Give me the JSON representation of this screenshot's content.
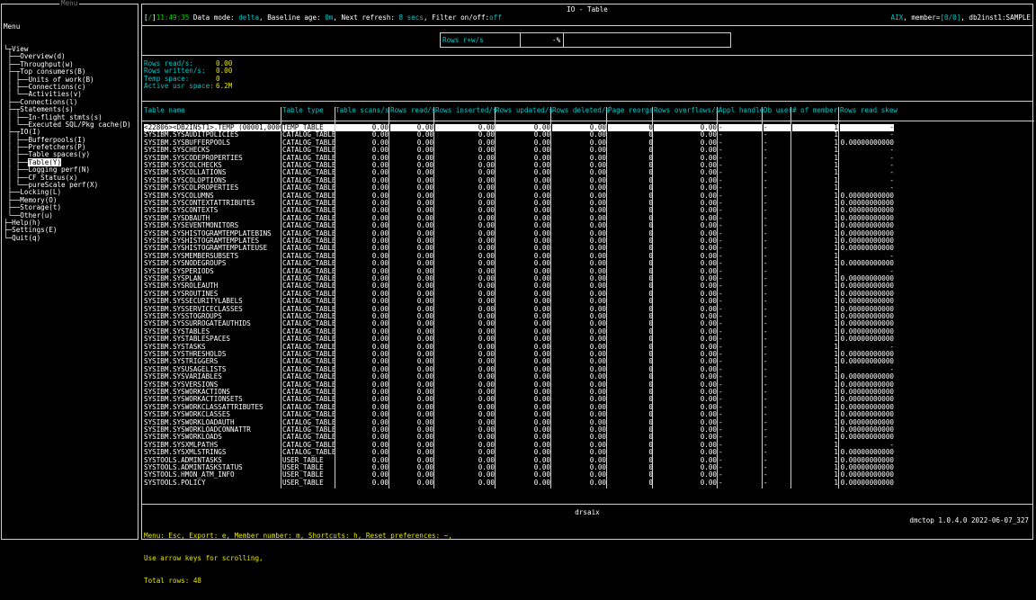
{
  "menu": {
    "caption": "Menu",
    "title": "Menu",
    "items": [
      {
        "prefix": "└┬",
        "label": "View"
      },
      {
        "prefix": " ├──",
        "label": "Overview(d)"
      },
      {
        "prefix": " ├──",
        "label": "Throughput(w)"
      },
      {
        "prefix": " ├─┬",
        "label": "Top consumers(B)"
      },
      {
        "prefix": " │ ├──",
        "label": "Units of work(B)"
      },
      {
        "prefix": " │ ├──",
        "label": "Connections(c)"
      },
      {
        "prefix": " │ └──",
        "label": "Activities(v)"
      },
      {
        "prefix": " ├──",
        "label": "Connections(l)"
      },
      {
        "prefix": " ├─┬",
        "label": "Statements(s)"
      },
      {
        "prefix": " │ ├──",
        "label": "In-flight stmts(s)"
      },
      {
        "prefix": " │ └──",
        "label": "Executed SQL/Pkg cache(D)"
      },
      {
        "prefix": " ├─┬",
        "label": "IO(I)"
      },
      {
        "prefix": " │ ├──",
        "label": "Bufferpools(I)"
      },
      {
        "prefix": " │ ├──",
        "label": "Prefetchers(P)"
      },
      {
        "prefix": " │ ├──",
        "label": "Table spaces(y)"
      },
      {
        "prefix": " │ ├──",
        "label": "Table(Y)",
        "selected": true
      },
      {
        "prefix": " │ ├──",
        "label": "Logging perf(N)"
      },
      {
        "prefix": " │ ├──",
        "label": "CF Status(x)"
      },
      {
        "prefix": " │ └──",
        "label": "pureScale perf(X)"
      },
      {
        "prefix": " ├──",
        "label": "Locking(L)"
      },
      {
        "prefix": " ├──",
        "label": "Memory(O)"
      },
      {
        "prefix": " ├──",
        "label": "Storage(t)"
      },
      {
        "prefix": " └──",
        "label": "Other(u)"
      },
      {
        "prefix": "├─",
        "label": "Help(h)"
      },
      {
        "prefix": "├─",
        "label": "Settings(E)"
      },
      {
        "prefix": "└─",
        "label": "Quit(q)"
      }
    ]
  },
  "window": {
    "title": "IO - Table",
    "status": {
      "bracket_open": "[",
      "indicator": "/",
      "bracket_close": "]",
      "time": "11:49:35",
      "data_mode_label": " Data mode: ",
      "data_mode": "delta",
      "baseline_label": ", Baseline age: ",
      "baseline": "0m",
      "refresh_label": ", Next refresh: ",
      "refresh": "8 secs",
      "filter_label": ", Filter on/off:",
      "filter": "off",
      "platform": "AIX",
      "member_label": ", member=",
      "member": "[0/0]",
      "instance": ", db2inst1:SAMPLE"
    }
  },
  "gauge": {
    "label": "Rows r+w/s",
    "value": "-%"
  },
  "metrics": [
    {
      "label": "Rows read/s:",
      "value": "0.00"
    },
    {
      "label": "Rows written/s:",
      "value": "0.00"
    },
    {
      "label": "Temp space:",
      "value": "0"
    },
    {
      "label": "Active usr space:",
      "value": "6.2M"
    }
  ],
  "table": {
    "columns": [
      "Table name",
      "Table type",
      "Table scans/s",
      "Rows read/s",
      "Rows inserted/s",
      "Rows updated/s",
      "Rows deleted/s",
      "Page reorgs",
      "Rows overflows/s",
      "Appl handle",
      "Db user",
      "# of member",
      "Rows read skew"
    ],
    "rows": [
      [
        "<22806><DB2INST1>.TEMP (00001,00002)",
        "TEMP_TABLE",
        "0.00",
        "0.00",
        "0.00",
        "0.00",
        "0.00",
        "0",
        "0.00",
        "-",
        "-",
        "1",
        "-"
      ],
      [
        "SYSIBM.SYSAUDITPOLICIES",
        "CATALOG_TABLE",
        "0.00",
        "0.00",
        "0.00",
        "0.00",
        "0.00",
        "0",
        "0.00",
        "-",
        "-",
        "1",
        "-"
      ],
      [
        "SYSIBM.SYSBUFFERPOOLS",
        "CATALOG_TABLE",
        "0.00",
        "0.00",
        "0.00",
        "0.00",
        "0.00",
        "0",
        "0.00",
        "-",
        "-",
        "1",
        "0.00000000000"
      ],
      [
        "SYSIBM.SYSCHECKS",
        "CATALOG_TABLE",
        "0.00",
        "0.00",
        "0.00",
        "0.00",
        "0.00",
        "0",
        "0.00",
        "-",
        "-",
        "1",
        "-"
      ],
      [
        "SYSIBM.SYSCODEPROPERTIES",
        "CATALOG_TABLE",
        "0.00",
        "0.00",
        "0.00",
        "0.00",
        "0.00",
        "0",
        "0.00",
        "-",
        "-",
        "1",
        "-"
      ],
      [
        "SYSIBM.SYSCOLCHECKS",
        "CATALOG_TABLE",
        "0.00",
        "0.00",
        "0.00",
        "0.00",
        "0.00",
        "0",
        "0.00",
        "-",
        "-",
        "1",
        "-"
      ],
      [
        "SYSIBM.SYSCOLLATIONS",
        "CATALOG_TABLE",
        "0.00",
        "0.00",
        "0.00",
        "0.00",
        "0.00",
        "0",
        "0.00",
        "-",
        "-",
        "1",
        "-"
      ],
      [
        "SYSIBM.SYSCOLOPTIONS",
        "CATALOG_TABLE",
        "0.00",
        "0.00",
        "0.00",
        "0.00",
        "0.00",
        "0",
        "0.00",
        "-",
        "-",
        "1",
        "-"
      ],
      [
        "SYSIBM.SYSCOLPROPERTIES",
        "CATALOG_TABLE",
        "0.00",
        "0.00",
        "0.00",
        "0.00",
        "0.00",
        "0",
        "0.00",
        "-",
        "-",
        "1",
        "-"
      ],
      [
        "SYSIBM.SYSCOLUMNS",
        "CATALOG_TABLE",
        "0.00",
        "0.00",
        "0.00",
        "0.00",
        "0.00",
        "0",
        "0.00",
        "-",
        "-",
        "1",
        "0.00000000000"
      ],
      [
        "SYSIBM.SYSCONTEXTATTRIBUTES",
        "CATALOG_TABLE",
        "0.00",
        "0.00",
        "0.00",
        "0.00",
        "0.00",
        "0",
        "0.00",
        "-",
        "-",
        "1",
        "0.00000000000"
      ],
      [
        "SYSIBM.SYSCONTEXTS",
        "CATALOG_TABLE",
        "0.00",
        "0.00",
        "0.00",
        "0.00",
        "0.00",
        "0",
        "0.00",
        "-",
        "-",
        "1",
        "0.00000000000"
      ],
      [
        "SYSIBM.SYSDBAUTH",
        "CATALOG_TABLE",
        "0.00",
        "0.00",
        "0.00",
        "0.00",
        "0.00",
        "0",
        "0.00",
        "-",
        "-",
        "1",
        "0.00000000000"
      ],
      [
        "SYSIBM.SYSEVENTMONITORS",
        "CATALOG_TABLE",
        "0.00",
        "0.00",
        "0.00",
        "0.00",
        "0.00",
        "0",
        "0.00",
        "-",
        "-",
        "1",
        "0.00000000000"
      ],
      [
        "SYSIBM.SYSHISTOGRAMTEMPLATEBINS",
        "CATALOG_TABLE",
        "0.00",
        "0.00",
        "0.00",
        "0.00",
        "0.00",
        "0",
        "0.00",
        "-",
        "-",
        "1",
        "0.00000000000"
      ],
      [
        "SYSIBM.SYSHISTOGRAMTEMPLATES",
        "CATALOG_TABLE",
        "0.00",
        "0.00",
        "0.00",
        "0.00",
        "0.00",
        "0",
        "0.00",
        "-",
        "-",
        "1",
        "0.00000000000"
      ],
      [
        "SYSIBM.SYSHISTOGRAMTEMPLATEUSE",
        "CATALOG_TABLE",
        "0.00",
        "0.00",
        "0.00",
        "0.00",
        "0.00",
        "0",
        "0.00",
        "-",
        "-",
        "1",
        "0.00000000000"
      ],
      [
        "SYSIBM.SYSMEMBERSUBSETS",
        "CATALOG_TABLE",
        "0.00",
        "0.00",
        "0.00",
        "0.00",
        "0.00",
        "0",
        "0.00",
        "-",
        "-",
        "1",
        "-"
      ],
      [
        "SYSIBM.SYSNODEGROUPS",
        "CATALOG_TABLE",
        "0.00",
        "0.00",
        "0.00",
        "0.00",
        "0.00",
        "0",
        "0.00",
        "-",
        "-",
        "1",
        "0.00000000000"
      ],
      [
        "SYSIBM.SYSPERIODS",
        "CATALOG_TABLE",
        "0.00",
        "0.00",
        "0.00",
        "0.00",
        "0.00",
        "0",
        "0.00",
        "-",
        "-",
        "1",
        "-"
      ],
      [
        "SYSIBM.SYSPLAN",
        "CATALOG_TABLE",
        "0.00",
        "0.00",
        "0.00",
        "0.00",
        "0.00",
        "0",
        "0.00",
        "-",
        "-",
        "1",
        "0.00000000000"
      ],
      [
        "SYSIBM.SYSROLEAUTH",
        "CATALOG_TABLE",
        "0.00",
        "0.00",
        "0.00",
        "0.00",
        "0.00",
        "0",
        "0.00",
        "-",
        "-",
        "1",
        "0.00000000000"
      ],
      [
        "SYSIBM.SYSROUTINES",
        "CATALOG_TABLE",
        "0.00",
        "0.00",
        "0.00",
        "0.00",
        "0.00",
        "0",
        "0.00",
        "-",
        "-",
        "1",
        "0.00000000000"
      ],
      [
        "SYSIBM.SYSSECURITYLABELS",
        "CATALOG_TABLE",
        "0.00",
        "0.00",
        "0.00",
        "0.00",
        "0.00",
        "0",
        "0.00",
        "-",
        "-",
        "1",
        "0.00000000000"
      ],
      [
        "SYSIBM.SYSSERVICECLASSES",
        "CATALOG_TABLE",
        "0.00",
        "0.00",
        "0.00",
        "0.00",
        "0.00",
        "0",
        "0.00",
        "-",
        "-",
        "1",
        "0.00000000000"
      ],
      [
        "SYSIBM.SYSSTOGROUPS",
        "CATALOG_TABLE",
        "0.00",
        "0.00",
        "0.00",
        "0.00",
        "0.00",
        "0",
        "0.00",
        "-",
        "-",
        "1",
        "0.00000000000"
      ],
      [
        "SYSIBM.SYSSURROGATEAUTHIDS",
        "CATALOG_TABLE",
        "0.00",
        "0.00",
        "0.00",
        "0.00",
        "0.00",
        "0",
        "0.00",
        "-",
        "-",
        "1",
        "0.00000000000"
      ],
      [
        "SYSIBM.SYSTABLES",
        "CATALOG_TABLE",
        "0.00",
        "0.00",
        "0.00",
        "0.00",
        "0.00",
        "0",
        "0.00",
        "-",
        "-",
        "1",
        "0.00000000000"
      ],
      [
        "SYSIBM.SYSTABLESPACES",
        "CATALOG_TABLE",
        "0.00",
        "0.00",
        "0.00",
        "0.00",
        "0.00",
        "0",
        "0.00",
        "-",
        "-",
        "1",
        "0.00000000000"
      ],
      [
        "SYSIBM.SYSTASKS",
        "CATALOG_TABLE",
        "0.00",
        "0.00",
        "0.00",
        "0.00",
        "0.00",
        "0",
        "0.00",
        "-",
        "-",
        "1",
        "-"
      ],
      [
        "SYSIBM.SYSTHRESHOLDS",
        "CATALOG_TABLE",
        "0.00",
        "0.00",
        "0.00",
        "0.00",
        "0.00",
        "0",
        "0.00",
        "-",
        "-",
        "1",
        "0.00000000000"
      ],
      [
        "SYSIBM.SYSTRIGGERS",
        "CATALOG_TABLE",
        "0.00",
        "0.00",
        "0.00",
        "0.00",
        "0.00",
        "0",
        "0.00",
        "-",
        "-",
        "1",
        "0.00000000000"
      ],
      [
        "SYSIBM.SYSUSAGELISTS",
        "CATALOG_TABLE",
        "0.00",
        "0.00",
        "0.00",
        "0.00",
        "0.00",
        "0",
        "0.00",
        "-",
        "-",
        "1",
        "-"
      ],
      [
        "SYSIBM.SYSVARIABLES",
        "CATALOG_TABLE",
        "0.00",
        "0.00",
        "0.00",
        "0.00",
        "0.00",
        "0",
        "0.00",
        "-",
        "-",
        "1",
        "0.00000000000"
      ],
      [
        "SYSIBM.SYSVERSIONS",
        "CATALOG_TABLE",
        "0.00",
        "0.00",
        "0.00",
        "0.00",
        "0.00",
        "0",
        "0.00",
        "-",
        "-",
        "1",
        "0.00000000000"
      ],
      [
        "SYSIBM.SYSWORKACTIONS",
        "CATALOG_TABLE",
        "0.00",
        "0.00",
        "0.00",
        "0.00",
        "0.00",
        "0",
        "0.00",
        "-",
        "-",
        "1",
        "0.00000000000"
      ],
      [
        "SYSIBM.SYSWORKACTIONSETS",
        "CATALOG_TABLE",
        "0.00",
        "0.00",
        "0.00",
        "0.00",
        "0.00",
        "0",
        "0.00",
        "-",
        "-",
        "1",
        "0.00000000000"
      ],
      [
        "SYSIBM.SYSWORKCLASSATTRIBUTES",
        "CATALOG_TABLE",
        "0.00",
        "0.00",
        "0.00",
        "0.00",
        "0.00",
        "0",
        "0.00",
        "-",
        "-",
        "1",
        "0.00000000000"
      ],
      [
        "SYSIBM.SYSWORKCLASSES",
        "CATALOG_TABLE",
        "0.00",
        "0.00",
        "0.00",
        "0.00",
        "0.00",
        "0",
        "0.00",
        "-",
        "-",
        "1",
        "0.00000000000"
      ],
      [
        "SYSIBM.SYSWORKLOADAUTH",
        "CATALOG_TABLE",
        "0.00",
        "0.00",
        "0.00",
        "0.00",
        "0.00",
        "0",
        "0.00",
        "-",
        "-",
        "1",
        "0.00000000000"
      ],
      [
        "SYSIBM.SYSWORKLOADCONNATTR",
        "CATALOG_TABLE",
        "0.00",
        "0.00",
        "0.00",
        "0.00",
        "0.00",
        "0",
        "0.00",
        "-",
        "-",
        "1",
        "0.00000000000"
      ],
      [
        "SYSIBM.SYSWORKLOADS",
        "CATALOG_TABLE",
        "0.00",
        "0.00",
        "0.00",
        "0.00",
        "0.00",
        "0",
        "0.00",
        "-",
        "-",
        "1",
        "0.00000000000"
      ],
      [
        "SYSIBM.SYSXMLPATHS",
        "CATALOG_TABLE",
        "0.00",
        "0.00",
        "0.00",
        "0.00",
        "0.00",
        "0",
        "0.00",
        "-",
        "-",
        "1",
        "-"
      ],
      [
        "SYSIBM.SYSXMLSTRINGS",
        "CATALOG_TABLE",
        "0.00",
        "0.00",
        "0.00",
        "0.00",
        "0.00",
        "0",
        "0.00",
        "-",
        "-",
        "1",
        "0.00000000000"
      ],
      [
        "SYSTOOLS.ADMINTASKS",
        "USER_TABLE",
        "0.00",
        "0.00",
        "0.00",
        "0.00",
        "0.00",
        "0",
        "0.00",
        "-",
        "-",
        "1",
        "0.00000000000"
      ],
      [
        "SYSTOOLS.ADMINTASKSTATUS",
        "USER_TABLE",
        "0.00",
        "0.00",
        "0.00",
        "0.00",
        "0.00",
        "0",
        "0.00",
        "-",
        "-",
        "1",
        "0.00000000000"
      ],
      [
        "SYSTOOLS.HMON_ATM_INFO",
        "USER_TABLE",
        "0.00",
        "0.00",
        "0.00",
        "0.00",
        "0.00",
        "0",
        "0.00",
        "-",
        "-",
        "1",
        "0.00000000000"
      ],
      [
        "SYSTOOLS.POLICY",
        "USER_TABLE",
        "0.00",
        "0.00",
        "0.00",
        "0.00",
        "0.00",
        "0",
        "0.00",
        "-",
        "-",
        "1",
        "0.00000000000"
      ]
    ]
  },
  "bottom_title": "drsaix",
  "footer": {
    "line1": "Menu: Esc, Export: e, Member number: m, Shortcuts: h, Reset preferences: ~,",
    "line2": "Use arrow keys for scrolling,",
    "line3": "Total rows: 48",
    "version": "dmctop 1.0.4.0 2022-06-07_327"
  }
}
